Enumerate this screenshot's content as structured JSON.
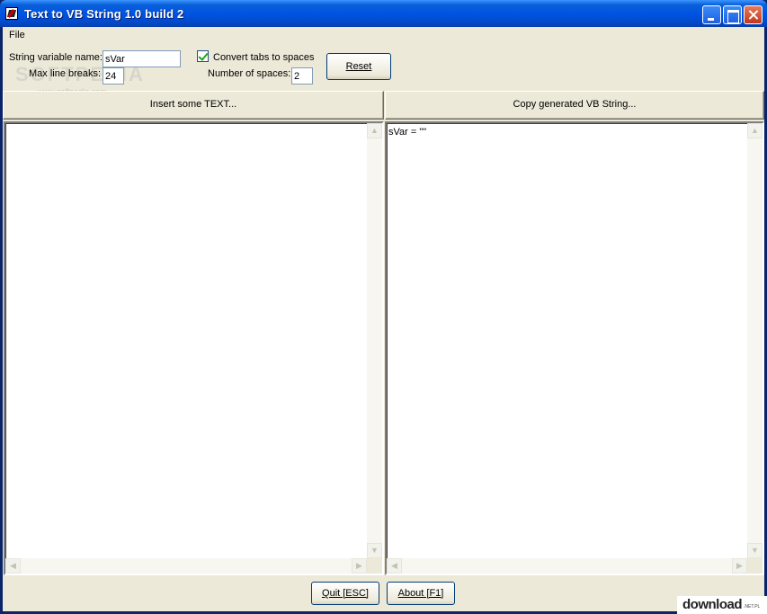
{
  "window": {
    "title": "Text to VB String 1.0 build 2"
  },
  "menu": {
    "file": "File"
  },
  "options": {
    "var_name_label": "String variable name:",
    "var_name_value": "sVar",
    "max_breaks_label": "Max line breaks:",
    "max_breaks_value": "24",
    "convert_tabs_label": "Convert tabs to spaces",
    "convert_tabs_checked": true,
    "num_spaces_label": "Number of spaces:",
    "num_spaces_value": "2",
    "reset_label": "Reset"
  },
  "toolbar": {
    "insert_label": "Insert some TEXT...",
    "copy_label": "Copy generated VB String..."
  },
  "input_pane": {
    "content": ""
  },
  "output_pane": {
    "content": "sVar = \"\""
  },
  "footer": {
    "quit_label": "Quit [ESC]",
    "about_label": "About [F1]"
  },
  "watermark": {
    "big": "SOFTPEDIA",
    "small": "www.softpedia.com"
  },
  "badge": {
    "text": "download",
    "sub": ".NET.PL"
  },
  "colors": {
    "titlebar": "#0054e3",
    "face": "#ece9d8",
    "close_button": "#c2381a"
  }
}
